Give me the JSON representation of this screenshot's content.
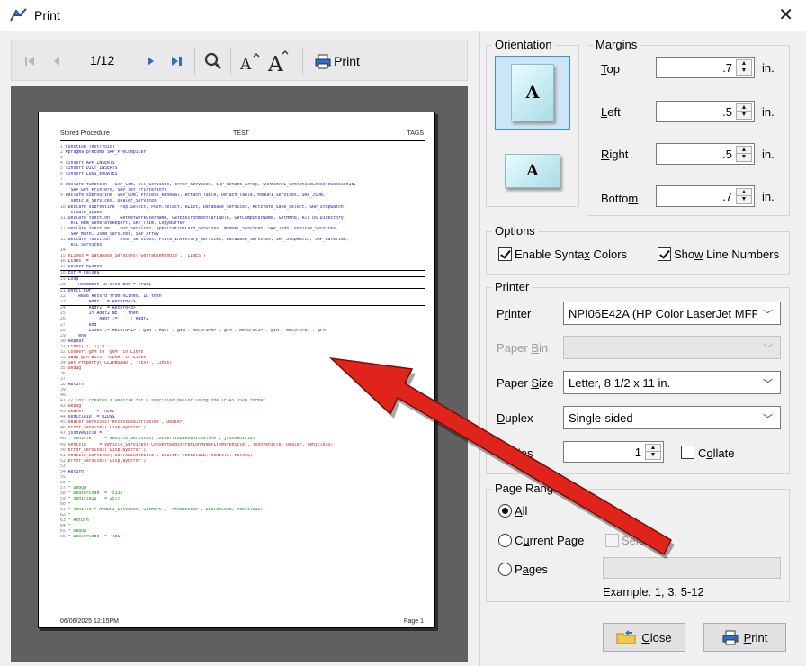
{
  "window": {
    "title": "Print",
    "close_glyph": "✕"
  },
  "toolbar": {
    "page_indicator": "1/12",
    "print_label": "Print",
    "icons": [
      "first-page-icon",
      "prev-page-icon",
      "next-page-icon",
      "last-page-icon",
      "zoom-icon",
      "font-smaller-icon",
      "font-larger-icon",
      "printer-icon"
    ]
  },
  "page_preview": {
    "header_left": "Stored Procedure",
    "header_center": "TEST",
    "header_right": "TAGS",
    "footer_left": "06/06/2025 12:15PM",
    "footer_right": "Page 1",
    "lines": [
      {
        "n": "1",
        "t": "Function Test(Void)",
        "c": "blue"
      },
      {
        "n": "2",
        "t": "#pragma precomp SRP_PreCompiler",
        "c": "blue"
      },
      {
        "n": "3",
        "t": "",
        "c": "blue"
      },
      {
        "n": "4",
        "t": "$insert APP_INSERTS",
        "c": "blue"
      },
      {
        "n": "5",
        "t": "$insert DICT_INSERTS",
        "c": "blue"
      },
      {
        "n": "6",
        "t": "$insert LOGS_EQUATES",
        "c": "blue"
      },
      {
        "n": "7",
        "t": "",
        "c": "blue"
      },
      {
        "n": "8",
        "t": "Declare function   SRP_Com, Dll_Services, Error_Services, SRP_Rotate_Array, SRPWinAPI_GetActiveConsoleSessionId,",
        "c": "blue"
      },
      {
        "n": "",
        "t": "SRP_Get_Printers, SRP_Set_PrinterInfo",
        "c": "blue"
      },
      {
        "n": "9",
        "t": "Declare subroutine  SRP_Com, Process_Renewal, Attach_Table, Detach_Table, MVNOPI_Services, SRP_JSON,",
        "c": "blue"
      },
      {
        "n": "",
        "t": "Vehicle_Services, Dealer_Services",
        "c": "blue"
      },
      {
        "n": "10",
        "t": "Declare subroutine  Pop.Select, Push.Select, RList, Database_Services, Activate_Save_Select, SRP_Stopwatch,",
        "c": "blue"
      },
      {
        "n": "",
        "t": "Create_Index",
        "c": "blue"
      },
      {
        "n": "11",
        "t": "Declare function    GetNetworkUserName, GetEnvironmentVariable, GetComputerName, GetHWnd, RTI_OS_Directory,",
        "c": "blue"
      },
      {
        "n": "",
        "t": "RTI_Rbm_GenerateReport, SRP_Trim, CopyBuffer",
        "c": "blue"
      },
      {
        "n": "12",
        "t": "Declare function    PDF_Services, ApplicationCard_Services, MVNOPI_Services, SRP_Json, Vehicle_Services,",
        "c": "blue"
      },
      {
        "n": "",
        "t": "SRP_Math, JSON_Services, SRP_Array",
        "c": "blue"
      },
      {
        "n": "13",
        "t": "Declare function    Json_Services, Plate_Inventory_Services, Database_Services, SRP_Stopwatch, SRP_DateTime,",
        "c": "blue"
      },
      {
        "n": "",
        "t": "RTI_Services",
        "c": "blue"
      },
      {
        "n": "14",
        "t": "",
        "c": "blue"
      },
      {
        "n": "15",
        "t": "hLines = Database_Services('GetTableHandle', 'LINES')",
        "c": "red"
      },
      {
        "n": "16",
        "t": "Lines  = ''",
        "c": "blue"
      },
      {
        "n": "17",
        "t": "Select hLines",
        "c": "blue",
        "rule": true
      },
      {
        "n": "18",
        "t": "EOF = False$",
        "c": "blue",
        "rule": true
      },
      {
        "n": "19",
        "t": "Loop",
        "c": "blue"
      },
      {
        "n": "20",
        "t": "    ReadNext ID else EOF = True$",
        "c": "blue",
        "rule": true
      },
      {
        "n": "21",
        "t": "Until EOF",
        "c": "blue"
      },
      {
        "n": "22",
        "t": "    Read Record from hLines, ID then",
        "c": "blue"
      },
      {
        "n": "23",
        "t": "        Addr   = Record<2>",
        "c": "blue",
        "rule": true
      },
      {
        "n": "24",
        "t": "        Addr2  = Record<3>",
        "c": "blue"
      },
      {
        "n": "25",
        "t": "        If Addr2 NE '' then",
        "c": "blue"
      },
      {
        "n": "26",
        "t": "            Addr := ' ' : Addr2",
        "c": "blue"
      },
      {
        "n": "27",
        "t": "        end",
        "c": "blue"
      },
      {
        "n": "28",
        "t": "        Lines := Record<1> : @VM : Addr : @VM : Record<4> : @VM : Record<5> : @VM : Record<6> : @FM",
        "c": "blue"
      },
      {
        "n": "29",
        "t": "    end",
        "c": "blue"
      },
      {
        "n": "30",
        "t": "Repeat",
        "c": "blue"
      },
      {
        "n": "31",
        "t": "Lines[-1, 1] = ''",
        "c": "red"
      },
      {
        "n": "32",
        "t": "Convert @FM to '@VM' in Lines",
        "c": "red"
      },
      {
        "n": "33",
        "t": "Swap @FM with '\\0D0A' in Lines",
        "c": "red"
      },
      {
        "n": "34",
        "t": "Set_Property('CLIPBOARD', 'TEXT', Lines)",
        "c": "red"
      },
      {
        "n": "35",
        "t": "Debug",
        "c": "red"
      },
      {
        "n": "36",
        "t": "",
        "c": "blue"
      },
      {
        "n": "37",
        "t": "",
        "c": "blue"
      },
      {
        "n": "38",
        "t": "Return ''",
        "c": "blue"
      },
      {
        "n": "39",
        "t": "",
        "c": "blue"
      },
      {
        "n": "40",
        "t": "",
        "c": "blue"
      },
      {
        "n": "41",
        "t": "// This creates a vehicle for a specified dealer using the TEXAS JSON format.",
        "c": "green"
      },
      {
        "n": "42",
        "t": "Debug",
        "c": "red"
      },
      {
        "n": "43",
        "t": "Dealer     = 'HERE'",
        "c": "red"
      },
      {
        "n": "44",
        "t": "VehicleID  = RZD$$",
        "c": "blue"
      },
      {
        "n": "45",
        "t": "Dealer_Services('AccessDealerTables', Dealer)",
        "c": "red"
      },
      {
        "n": "46",
        "t": "Error_Services('DisplayError')",
        "c": "red"
      },
      {
        "n": "47",
        "t": "jsonVehicle = ''",
        "c": "blue"
      },
      {
        "n": "48",
        "t": "* Vehicle     = Vehicle_Services('ConvertTXDLRVehicleToMV', jsonVehicle)",
        "c": "green"
      },
      {
        "n": "49",
        "t": "Vehicle     = Vehicle_Services('ConvertRegistrationMVNOPIToMVVehicle', jsonVehicle, Dealer, VehicleID)",
        "c": "red"
      },
      {
        "n": "50",
        "t": "Error_Services('DisplayError')",
        "c": "red"
      },
      {
        "n": "51",
        "t": "Vehicle_Services('SetTXDLRVehicle', Dealer, VehicleID, Vehicle, False$)",
        "c": "red"
      },
      {
        "n": "52",
        "t": "Error_Services('DisplayError')",
        "c": "red"
      },
      {
        "n": "53",
        "t": "",
        "c": "blue"
      },
      {
        "n": "54",
        "t": "Return ''",
        "c": "blue"
      },
      {
        "n": "55",
        "t": "",
        "c": "blue"
      },
      {
        "n": "56",
        "t": "*",
        "c": "green"
      },
      {
        "n": "57",
        "t": "* Debug",
        "c": "green"
      },
      {
        "n": "58",
        "t": "* DealerCode  = '5135'",
        "c": "green"
      },
      {
        "n": "59",
        "t": "* VehicleID   = 2577",
        "c": "green"
      },
      {
        "n": "60",
        "t": "*",
        "c": "green"
      },
      {
        "n": "61",
        "t": "* Vehicle = MVNOPI_Services('GetMVPR', 'Production', DealerCode, VehicleID)",
        "c": "green"
      },
      {
        "n": "62",
        "t": "*",
        "c": "green"
      },
      {
        "n": "63",
        "t": "* Return ''",
        "c": "green"
      },
      {
        "n": "64",
        "t": "*",
        "c": "green"
      },
      {
        "n": "65",
        "t": "* Debug",
        "c": "green"
      },
      {
        "n": "66",
        "t": "* DealerCode  = 'TEST'",
        "c": "green"
      }
    ]
  },
  "orientation": {
    "legend": "Orientation",
    "selected": "portrait",
    "glyph": "A"
  },
  "margins": {
    "legend": "Margins",
    "top": {
      "label_u": "T",
      "label_rest": "op",
      "value": ".7",
      "unit": "in."
    },
    "left": {
      "label_u": "L",
      "label_rest": "eft",
      "value": ".5",
      "unit": "in."
    },
    "right": {
      "label_u": "R",
      "label_rest": "ight",
      "value": ".5",
      "unit": "in."
    },
    "bottom": {
      "label_pre": "Botto",
      "label_u": "m",
      "value": ".7",
      "unit": "in."
    }
  },
  "options": {
    "legend": "Options",
    "syntax": {
      "pre": "Enable Synta",
      "u": "x",
      "post": " Colors",
      "checked": true
    },
    "linenums": {
      "pre": "Sho",
      "u": "w",
      "post": " Line Numbers",
      "checked": true
    }
  },
  "printer": {
    "legend": "Printer",
    "printer_label": {
      "pre": "P",
      "u": "r",
      "post": "inter"
    },
    "printer_value": "NPI06E42A (HP Color LaserJet MFP",
    "bin_label": {
      "pre": "Paper ",
      "u": "B",
      "post": "in"
    },
    "bin_value": "",
    "size_label": {
      "pre": "Paper ",
      "u": "S",
      "post": "ize"
    },
    "size_value": "Letter, 8 1/2 x 11 in.",
    "duplex_label": {
      "pre": "",
      "u": "D",
      "post": "uplex"
    },
    "duplex_value": "Single-sided",
    "copies_label": "Copies",
    "copies_value": "1",
    "collate": {
      "pre": "C",
      "u": "o",
      "post": "llate",
      "checked": false
    }
  },
  "page_range": {
    "legend": "Page Range",
    "all": {
      "pre": "",
      "u": "A",
      "post": "ll",
      "selected": true
    },
    "current": {
      "pre": "C",
      "u": "u",
      "post": "rrent Page",
      "selected": false
    },
    "selection": "Selection",
    "pages": {
      "pre": "P",
      "u": "a",
      "post": "ges",
      "selected": false
    },
    "pages_value": "",
    "example": "Example: 1, 3, 5-12"
  },
  "buttons": {
    "close": {
      "pre": "",
      "u": "C",
      "post": "lose"
    },
    "print": {
      "pre": "",
      "u": "P",
      "post": "rint"
    }
  },
  "colors": {
    "annotation_arrow": "#e0231b",
    "selection_blue": "#3a8fd6",
    "code_blue": "#1a1aa6",
    "code_green": "#0a8a0a",
    "code_red": "#c01818"
  }
}
